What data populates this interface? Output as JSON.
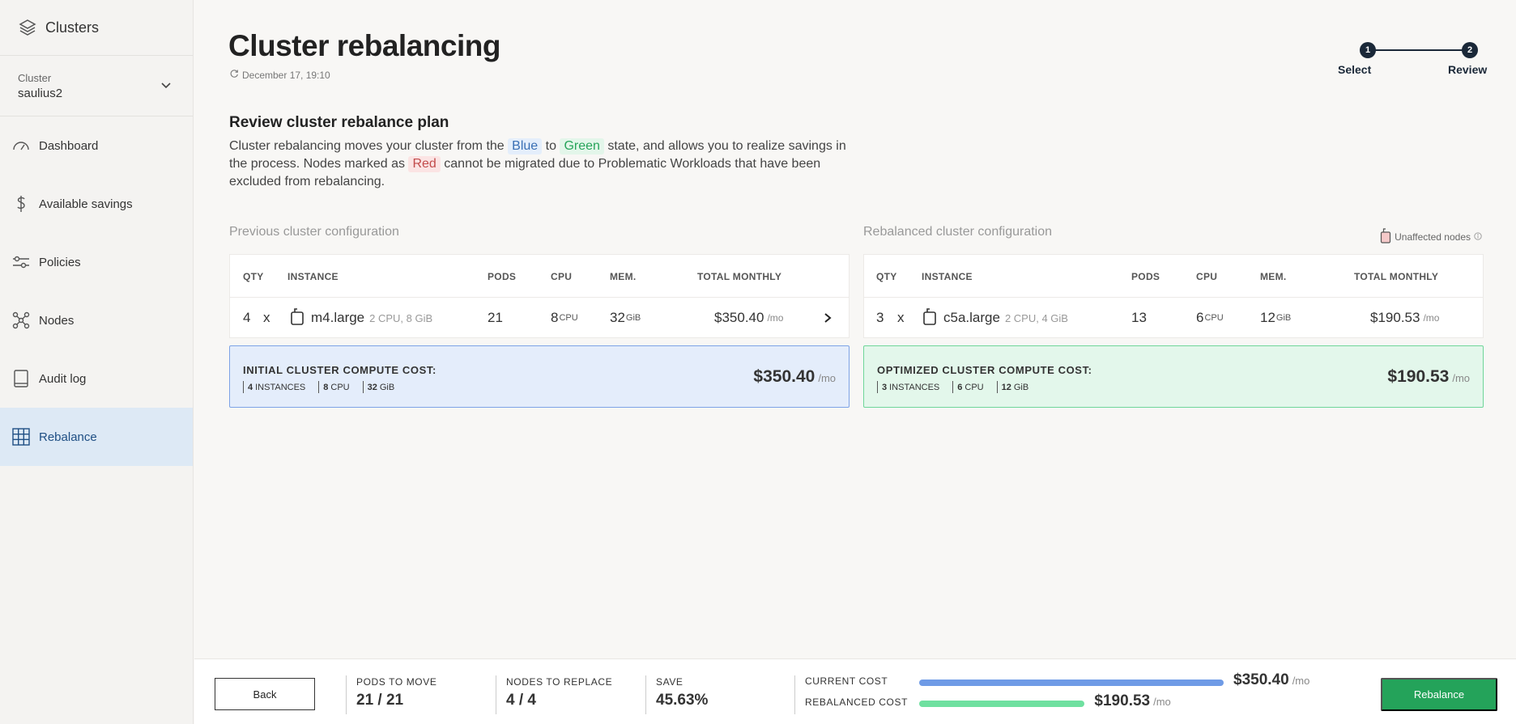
{
  "sidebar": {
    "brand": "Clusters",
    "cluster_label": "Cluster",
    "cluster_value": "saulius2",
    "items": [
      {
        "label": "Dashboard",
        "icon": "gauge-icon"
      },
      {
        "label": "Available savings",
        "icon": "dollar-icon"
      },
      {
        "label": "Policies",
        "icon": "sliders-icon"
      },
      {
        "label": "Nodes",
        "icon": "nodes-icon"
      },
      {
        "label": "Audit log",
        "icon": "book-icon"
      },
      {
        "label": "Rebalance",
        "icon": "grid-icon",
        "active": true
      }
    ]
  },
  "header": {
    "title": "Cluster rebalancing",
    "date": "December 17, 19:10"
  },
  "stepper": {
    "steps": [
      {
        "num": "1",
        "label": "Select"
      },
      {
        "num": "2",
        "label": "Review"
      }
    ]
  },
  "review": {
    "title": "Review cluster rebalance plan",
    "desc_1": "Cluster rebalancing moves your cluster from the",
    "tag_blue": "Blue",
    "desc_2": "to",
    "tag_green": "Green",
    "desc_3": "state, and allows you to realize savings in the process. Nodes marked as",
    "tag_red": "Red",
    "desc_4": "cannot be migrated due to Problematic Workloads that have been excluded from rebalancing."
  },
  "previous": {
    "heading": "Previous cluster configuration",
    "columns": [
      "QTY",
      "INSTANCE",
      "PODS",
      "CPU",
      "MEM.",
      "TOTAL MONTHLY"
    ],
    "row": {
      "qty": "4",
      "x": "x",
      "instance": "m4.large",
      "spec": "2 CPU, 8 GiB",
      "pods": "21",
      "cpu": "8",
      "cpu_unit": "CPU",
      "mem": "32",
      "mem_unit": "GiB",
      "monthly": "$350.40",
      "monthly_unit": "/mo"
    },
    "cost": {
      "title": "INITIAL CLUSTER COMPUTE COST:",
      "instances": "4",
      "instances_lbl": "INSTANCES",
      "cpu": "8",
      "cpu_lbl": "CPU",
      "mem": "32",
      "mem_lbl": "GiB",
      "price": "$350.40",
      "unit": "/mo"
    }
  },
  "rebalanced": {
    "heading": "Rebalanced cluster configuration",
    "unaffected": "Unaffected nodes",
    "columns": [
      "QTY",
      "INSTANCE",
      "PODS",
      "CPU",
      "MEM.",
      "TOTAL MONTHLY"
    ],
    "row": {
      "qty": "3",
      "x": "x",
      "instance": "c5a.large",
      "spec": "2 CPU, 4 GiB",
      "pods": "13",
      "cpu": "6",
      "cpu_unit": "CPU",
      "mem": "12",
      "mem_unit": "GiB",
      "monthly": "$190.53",
      "monthly_unit": "/mo"
    },
    "cost": {
      "title": "OPTIMIZED CLUSTER COMPUTE COST:",
      "instances": "3",
      "instances_lbl": "INSTANCES",
      "cpu": "6",
      "cpu_lbl": "CPU",
      "mem": "12",
      "mem_lbl": "GiB",
      "price": "$190.53",
      "unit": "/mo"
    }
  },
  "bottom": {
    "back": "Back",
    "pods_label": "PODS TO MOVE",
    "pods_value": "21 / 21",
    "nodes_label": "NODES TO REPLACE",
    "nodes_value": "4 / 4",
    "save_label": "SAVE",
    "save_value": "45.63%",
    "current_label": "CURRENT COST",
    "current_value": "$350.40",
    "rebalanced_label": "REBALANCED COST",
    "rebalanced_value": "$190.53",
    "unit": "/mo",
    "current_fraction": 1.0,
    "rebalanced_fraction": 0.5437,
    "rebalance_btn": "Rebalance"
  },
  "colors": {
    "accent_blue": "#6f9be6",
    "accent_green": "#24a35a",
    "active_nav": "#dde9f5",
    "stepper": "#1a2838"
  }
}
